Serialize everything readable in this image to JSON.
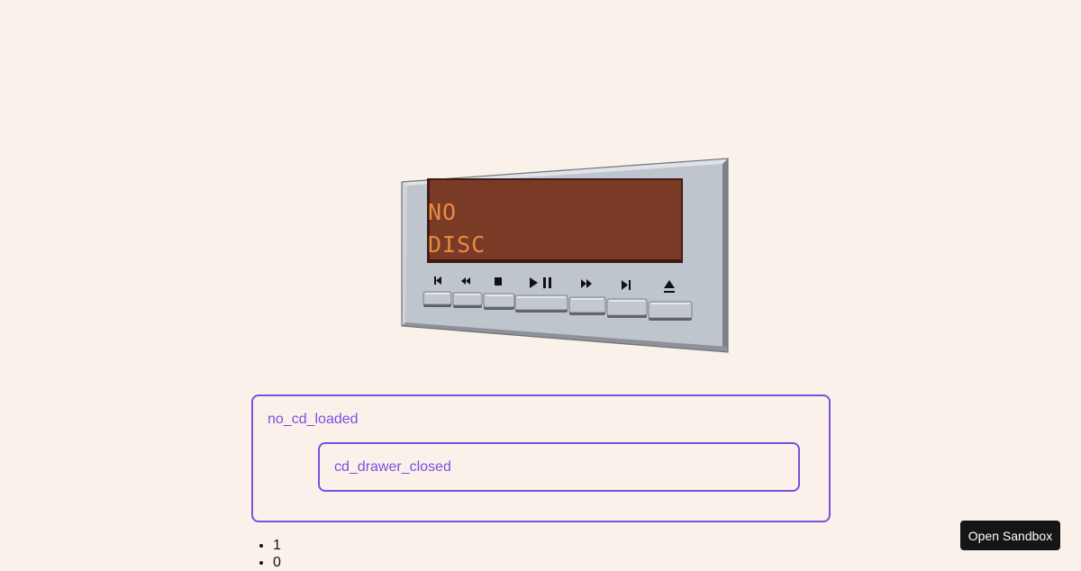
{
  "player": {
    "display_line1": "NO",
    "display_line2": "DISC",
    "lcd_color": "#7a3b26",
    "lcd_text_color": "#e88a42",
    "body_color": "#bfc5cd",
    "buttons": [
      {
        "name": "previous-track",
        "icon": "skip-back-icon"
      },
      {
        "name": "rewind",
        "icon": "rewind-icon"
      },
      {
        "name": "stop",
        "icon": "stop-icon"
      },
      {
        "name": "play-pause",
        "icon": "play-pause-icon"
      },
      {
        "name": "fast-forward",
        "icon": "fast-forward-icon"
      },
      {
        "name": "next-track",
        "icon": "skip-forward-icon"
      },
      {
        "name": "eject",
        "icon": "eject-icon"
      }
    ]
  },
  "states": {
    "outer_label": "no_cd_loaded",
    "inner_label": "cd_drawer_closed",
    "accent_color": "#7b4fe0"
  },
  "counters": [
    "1",
    "0"
  ],
  "sandbox_button_label": "Open Sandbox"
}
